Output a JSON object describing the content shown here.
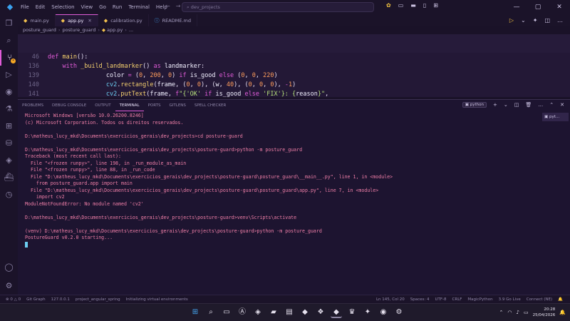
{
  "titlebar": {
    "menu": [
      "File",
      "Edit",
      "Selection",
      "View",
      "Go",
      "Run",
      "Terminal",
      "Help"
    ],
    "search_placeholder": "dev_projects"
  },
  "tabs": [
    {
      "label": "main.py",
      "icon": "python-file-icon",
      "active": false
    },
    {
      "label": "app.py",
      "icon": "python-file-icon",
      "active": true
    },
    {
      "label": "calibration.py",
      "icon": "python-file-icon",
      "active": false
    },
    {
      "label": "README.md",
      "icon": "info-file-icon",
      "active": false
    }
  ],
  "breadcrumbs": [
    "posture_guard",
    "posture_guard",
    "app.py",
    "..."
  ],
  "code": {
    "lines": [
      "42",
      "46",
      "136",
      "139",
      "140",
      "141",
      "142"
    ]
  },
  "panel": {
    "tabs": [
      "PROBLEMS",
      "DEBUG CONSOLE",
      "OUTPUT",
      "TERMINAL",
      "PORTS",
      "GITLENS",
      "SPELL CHECKER"
    ],
    "active_tab": "TERMINAL",
    "terminal_name": "python",
    "side_terminal": "pyt..."
  },
  "terminal": {
    "lines": [
      "Microsoft Windows [versão 10.0.26200.8246]",
      "(c) Microsoft Corporation. Todos os direitos reservados.",
      "",
      "D:\\matheus_lucy_mkd\\Documents\\exercicios_gerais\\dev_projects>cd posture-guard",
      "",
      "D:\\matheus_lucy_mkd\\Documents\\exercicios_gerais\\dev_projects\\posture-guard>python -m posture_guard",
      "Traceback (most recent call last):",
      "  File \"<frozen runpy>\", line 198, in _run_module_as_main",
      "  File \"<frozen runpy>\", line 88, in _run_code",
      "  File \"D:\\matheus_lucy_mkd\\Documents\\exercicios_gerais\\dev_projects\\posture-guard\\posture_guard\\__main__.py\", line 1, in <module>",
      "    from posture_guard.app import main",
      "  File \"D:\\matheus_lucy_mkd\\Documents\\exercicios_gerais\\dev_projects\\posture-guard\\posture_guard\\app.py\", line 7, in <module>",
      "    import cv2",
      "ModuleNotFoundError: No module named 'cv2'",
      "",
      "D:\\matheus_lucy_mkd\\Documents\\exercicios_gerais\\dev_projects\\posture-guard>venv\\Scripts\\activate",
      "",
      "(venv) D:\\matheus_lucy_mkd\\Documents\\exercicios_gerais\\dev_projects\\posture-guard>python -m posture_guard",
      "PostureGuard v0.2.0 starting..."
    ]
  },
  "statusbar": {
    "left": [
      "⊗ 0 △ 0",
      "Git Graph",
      "127.0.0.1",
      "project_angular_spring",
      "Initializing virtual environments"
    ],
    "right": [
      "Ln 145, Col 20",
      "Spaces: 4",
      "UTF-8",
      "CRLF",
      "MagicPython",
      "3.9 Go Live",
      "Connect (NE)"
    ]
  },
  "taskbar": {
    "time": "20:28",
    "date": "25/04/2026"
  }
}
